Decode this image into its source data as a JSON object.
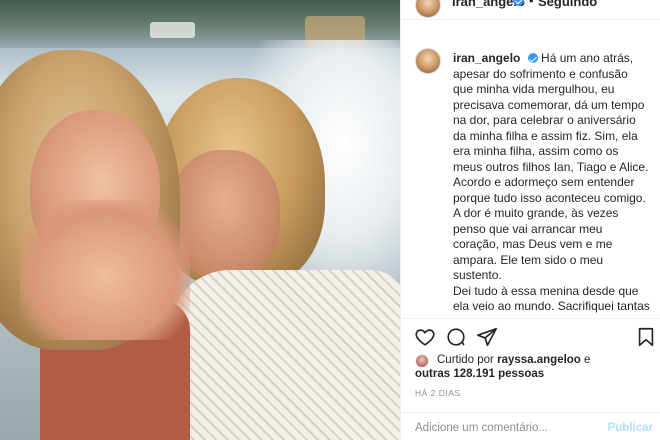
{
  "post": {
    "username": "iran_angelo",
    "follow_status": "Seguindo",
    "follow_separator": "•",
    "more_label": "•••",
    "caption": {
      "username": "iran_angelo",
      "paragraphs": [
        "Há um ano atrás, apesar do sofrimento e confusão que minha vida mergulhou, eu precisava comemorar, dá um tempo na dor, para celebrar o aniversário da minha filha e assim fiz. Sim, ela era minha filha, assim como os meus outros filhos Ian, Tiago e Alice.",
        "Acordo e adormeço sem entender porque tudo isso aconteceu comigo. A dor é muito grande, às vezes penso que vai arrancar meu coração, mas Deus vem e me ampara. Ele tem sido o meu sustento.",
        "Dei tudo à essa menina desde que ela veio ao mundo. Sacrifiquei tantas vezes meus sonhos para realizar os sonhos dela. E aqui não falo só de"
      ]
    },
    "likes": {
      "prefix": "Curtido por",
      "liked_by": "rayssa.angeloo",
      "and": "e",
      "others": "outras 128.191 pessoas"
    },
    "timestamp": "HÁ 2 DIAS",
    "comment_placeholder": "Adicione um comentário...",
    "publish_label": "Publicar"
  },
  "icons": {
    "like": "heart-icon",
    "comment": "comment-icon",
    "share": "share-icon",
    "save": "bookmark-icon",
    "verified": "verified-badge-icon"
  },
  "colors": {
    "verified": "#3897f0",
    "publish_disabled": "#b2dffc",
    "muted_text": "#8e8e8e",
    "text": "#262626"
  }
}
